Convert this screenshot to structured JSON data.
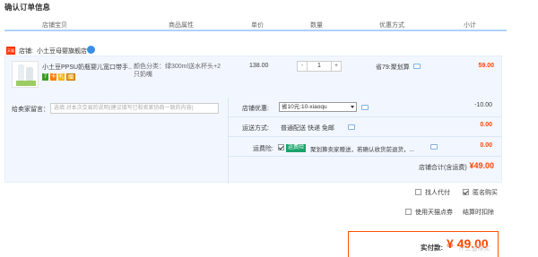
{
  "page_title": "确认订单信息",
  "columns": {
    "item": "店铺宝贝",
    "attr": "商品属性",
    "price": "单价",
    "qty": "数量",
    "promo": "优惠方式",
    "subtotal": "小计"
  },
  "shop": {
    "badge": "天猫",
    "label": "店铺:",
    "name": "小土豆母婴旗舰店"
  },
  "item": {
    "title": "小土豆PPSU奶瓶婴儿宽口带手...",
    "tags": [
      "7",
      "卡",
      "礼",
      "赠"
    ],
    "attr_line1": "颜色分类：绿300ml送水杯头+2",
    "attr_line2": "只奶嘴",
    "price": "138.00",
    "qty_minus": "-",
    "qty_value": "1",
    "qty_plus": "+",
    "promo": "省79:聚划算",
    "subtotal": "59.00"
  },
  "message": {
    "label": "给卖家留言：",
    "placeholder": "选填:对本次交易的说明(建议填写已和卖家协商一致的内容)"
  },
  "coupon": {
    "label": "店铺优惠:",
    "selected": "省10元:10-xiaoqu",
    "amount": "-10.00"
  },
  "shipping": {
    "label": "运送方式:",
    "value": "普通配送 快递 免邮",
    "amount": "0.00"
  },
  "insurance": {
    "label": "运费险:",
    "checked": true,
    "badge": "运费险",
    "text": "聚划算卖家赠送，若确认收货前退货，...",
    "amount": "0.00"
  },
  "shop_total": {
    "label": "店铺合计(含运费)",
    "value": "¥49.00"
  },
  "options": {
    "pay_for_me": "找人代付",
    "anonymous": "匿名购买",
    "tmall_points": "使用天猫点券",
    "settle_label": "结算时扣除"
  },
  "grand_total": {
    "label": "实付款:",
    "value": "¥ 49.00"
  },
  "watermark": "什么值得买",
  "colors": {
    "accent": "#ff4400",
    "header_line": "#b2d1ff",
    "panel_bg": "#f2f7ff",
    "insurance_green": "#1aa36b"
  }
}
